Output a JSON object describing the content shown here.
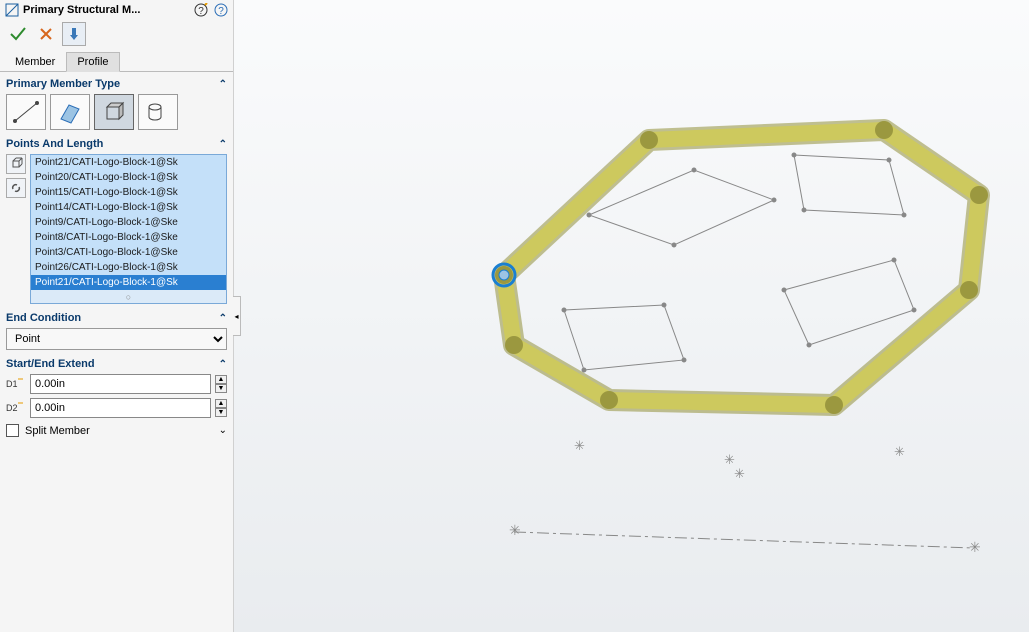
{
  "title": "Primary Structural M...",
  "tabs": {
    "member": "Member",
    "profile": "Profile"
  },
  "sections": {
    "memberType": "Primary Member Type",
    "pointsLength": "Points And Length",
    "endCondition": "End Condition",
    "startEndExtend": "Start/End Extend",
    "splitMember": "Split Member"
  },
  "endCondition": {
    "options": [
      "Point"
    ],
    "selected": "Point"
  },
  "extend": {
    "d1": "0.00in",
    "d2": "0.00in"
  },
  "memberTypeIcons": [
    "line-icon",
    "plane-icon",
    "box-icon",
    "cylinder-icon"
  ],
  "pointsSideIcons": [
    "cube-icon",
    "link-icon"
  ],
  "points": [
    "Point21/CATI-Logo-Block-1@Sk",
    "Point20/CATI-Logo-Block-1@Sk",
    "Point15/CATI-Logo-Block-1@Sk",
    "Point14/CATI-Logo-Block-1@Sk",
    "Point9/CATI-Logo-Block-1@Ske",
    "Point8/CATI-Logo-Block-1@Ske",
    "Point3/CATI-Logo-Block-1@Ske",
    "Point26/CATI-Logo-Block-1@Sk",
    "Point21/CATI-Logo-Block-1@Sk"
  ],
  "help": {
    "tooltip": "?",
    "info": "?"
  },
  "confirm": {
    "ok": "✓",
    "cancel": "✕",
    "pin": "📌"
  }
}
